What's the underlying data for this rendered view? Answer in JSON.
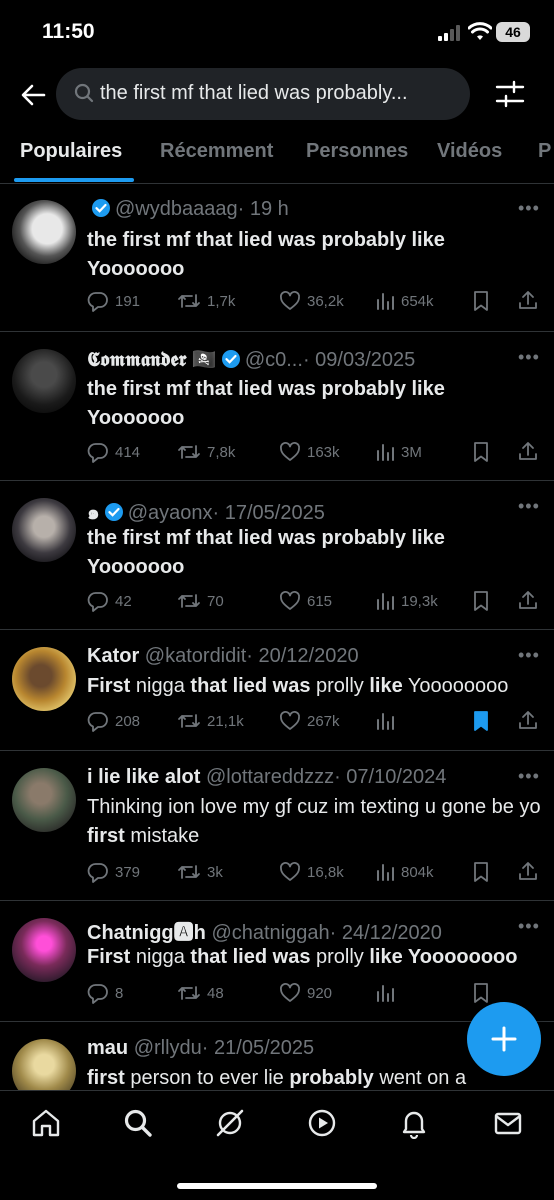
{
  "status": {
    "time": "11:50",
    "battery": "46"
  },
  "search": {
    "query": "the first mf that lied was probably..."
  },
  "tabs": [
    {
      "label": "Populaires",
      "active": true
    },
    {
      "label": "Récemment"
    },
    {
      "label": "Personnes"
    },
    {
      "label": "Vidéos"
    },
    {
      "label": "P"
    }
  ],
  "tweets": [
    {
      "name": "",
      "handle": "@wydbaaaag",
      "time": "· 19 h",
      "verified": true,
      "text": "the first mf that lied was probably like Yooooooo",
      "replies": "191",
      "reposts": "1,7k",
      "likes": "36,2k",
      "views": "654k",
      "bookmarked": false
    },
    {
      "name": "𝕮𝖔𝖒𝖒𝖆𝖓𝖉𝖊𝖗 🏴‍☠️",
      "handle": "@c0...",
      "time": "· 09/03/2025",
      "verified": true,
      "text": "the first mf that lied was probably like Yooooooo",
      "replies": "414",
      "reposts": "7,8k",
      "likes": "163k",
      "views": "3M",
      "bookmarked": false
    },
    {
      "name": "๑",
      "handle": "@ayaonx",
      "time": "· 17/05/2025",
      "verified": true,
      "text": "the first mf that lied was probably like Yooooooo",
      "replies": "42",
      "reposts": "70",
      "likes": "615",
      "views": "19,3k",
      "bookmarked": false
    },
    {
      "name": "Kator",
      "handle": "@katordidit",
      "time": "· 20/12/2020",
      "verified": false,
      "text_parts": [
        "First",
        " nigga ",
        "that lied was",
        " prolly ",
        "like",
        " Yoooooooo"
      ],
      "replies": "208",
      "reposts": "21,1k",
      "likes": "267k",
      "views": "",
      "bookmarked": true
    },
    {
      "name": "i lie like alot",
      "handle": "@lottareddzzz",
      "time": "· 07/10/2024",
      "verified": false,
      "text_parts": [
        "Thinking ion love my gf cuz im texting u gone be yo ",
        "first",
        " mistake"
      ],
      "replies": "379",
      "reposts": "3k",
      "likes": "16,8k",
      "views": "804k",
      "bookmarked": false
    },
    {
      "name": "Chatnigg🅰h",
      "handle": "@chatniggah",
      "time": "· 24/12/2020",
      "verified": false,
      "text_parts": [
        "First",
        " nigga ",
        "that lied was",
        " prolly ",
        "like",
        " Yoooooooo"
      ],
      "replies": "8",
      "reposts": "48",
      "likes": "920",
      "views": "",
      "bookmarked": false
    },
    {
      "name": "mau",
      "handle": "@rllydu",
      "time": "· 21/05/2025",
      "verified": false,
      "text_parts": [
        "first",
        " person to ever lie ",
        "probably",
        " went on a"
      ]
    }
  ],
  "colors": {
    "accent": "#1d9bf0",
    "background": "#000000",
    "muted": "#71767b",
    "text": "#e7e9ea"
  },
  "icons": {
    "nav": [
      "home-icon",
      "search-icon",
      "grok-icon",
      "play-icon",
      "bell-icon",
      "mail-icon"
    ]
  }
}
